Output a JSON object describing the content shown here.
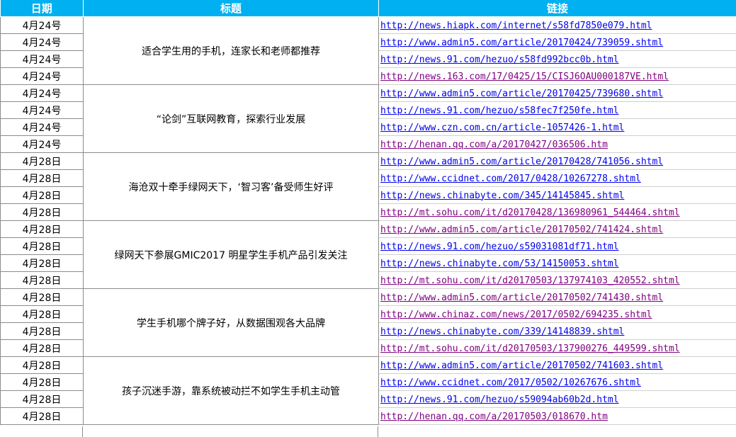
{
  "header": {
    "date": "日期",
    "title": "标题",
    "link": "链接"
  },
  "colors": {
    "header_bg": "#00b0f0",
    "link_unvisited": "#0000ee",
    "link_visited": "#800080"
  },
  "groups": [
    {
      "title": "适合学生用的手机，连家长和老师都推荐",
      "rows": [
        {
          "date": "4月24号",
          "url": "http://news.hiapk.com/internet/s58fd7850e079.html",
          "visited": false
        },
        {
          "date": "4月24号",
          "url": "http://www.admin5.com/article/20170424/739059.shtml",
          "visited": false
        },
        {
          "date": "4月24号",
          "url": "http://news.91.com/hezuo/s58fd992bcc0b.html",
          "visited": false
        },
        {
          "date": "4月24号",
          "url": "http://news.163.com/17/0425/15/CISJ6OAU000187VE.html",
          "visited": true
        }
      ]
    },
    {
      "title": "“论剑”互联网教育，探索行业发展",
      "rows": [
        {
          "date": "4月24号",
          "url": "http://www.admin5.com/article/20170425/739680.shtml",
          "visited": false
        },
        {
          "date": "4月24号",
          "url": "http://news.91.com/hezuo/s58fec7f250fe.html",
          "visited": false
        },
        {
          "date": "4月24号",
          "url": "http://www.czn.com.cn/article-1057426-1.html",
          "visited": false
        },
        {
          "date": "4月24号",
          "url": "http://henan.qq.com/a/20170427/036506.htm",
          "visited": true
        }
      ]
    },
    {
      "title": "海沧双十牵手绿网天下，‘智习客’备受师生好评",
      "rows": [
        {
          "date": "4月28日",
          "url": "http://www.admin5.com/article/20170428/741056.shtml",
          "visited": false
        },
        {
          "date": "4月28日",
          "url": "http://www.ccidnet.com/2017/0428/10267278.shtml",
          "visited": false
        },
        {
          "date": "4月28日",
          "url": "http://news.chinabyte.com/345/14145845.shtml",
          "visited": false
        },
        {
          "date": "4月28日",
          "url": "http://mt.sohu.com/it/d20170428/136980961_544464.shtml",
          "visited": true
        }
      ]
    },
    {
      "title": "绿网天下参展GMIC2017 明星学生手机产品引发关注",
      "rows": [
        {
          "date": "4月28日",
          "url": "http://www.admin5.com/article/20170502/741424.shtml",
          "visited": true
        },
        {
          "date": "4月28日",
          "url": "http://news.91.com/hezuo/s59031081df71.html",
          "visited": false
        },
        {
          "date": "4月28日",
          "url": "http://news.chinabyte.com/53/14150053.shtml",
          "visited": false
        },
        {
          "date": "4月28日",
          "url": "http://mt.sohu.com/it/d20170503/137974103_420552.shtml",
          "visited": true
        }
      ]
    },
    {
      "title": "学生手机哪个牌子好，从数据围观各大品牌",
      "rows": [
        {
          "date": "4月28日",
          "url": "http://www.admin5.com/article/20170502/741430.shtml",
          "visited": true
        },
        {
          "date": "4月28日",
          "url": "http://www.chinaz.com/news/2017/0502/694235.shtml",
          "visited": true
        },
        {
          "date": "4月28日",
          "url": "http://news.chinabyte.com/339/14148839.shtml",
          "visited": false
        },
        {
          "date": "4月28日",
          "url": "http://mt.sohu.com/it/d20170503/137900276_449599.shtml",
          "visited": true
        }
      ]
    },
    {
      "title": "孩子沉迷手游，靠系统被动拦不如学生手机主动管",
      "rows": [
        {
          "date": "4月28日",
          "url": "http://www.admin5.com/article/20170502/741603.shtml",
          "visited": false
        },
        {
          "date": "4月28日",
          "url": "http://www.ccidnet.com/2017/0502/10267676.shtml",
          "visited": false
        },
        {
          "date": "4月28日",
          "url": "http://news.91.com/hezuo/s59094ab60b2d.html",
          "visited": false
        },
        {
          "date": "4月28日",
          "url": "http://henan.qq.com/a/20170503/018670.htm",
          "visited": true
        }
      ]
    }
  ]
}
